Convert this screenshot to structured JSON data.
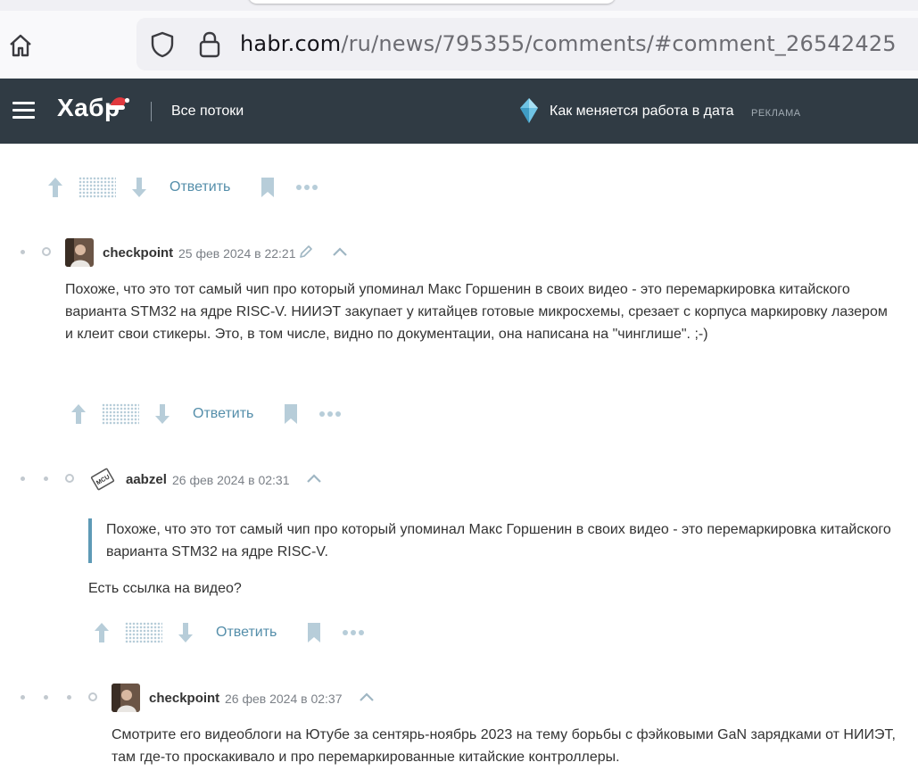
{
  "browser": {
    "url_host": "habr.com",
    "url_path": "/ru/news/795355/comments/#comment_26542425"
  },
  "header": {
    "logo": "Хабр",
    "streams": "Все потоки",
    "ad_text": "Как меняется работа в дата",
    "ad_label": "РЕКЛАМА"
  },
  "colors": {
    "header_bg": "#303b44",
    "link": "#548eaa",
    "quote_border": "#5e9ab6",
    "muted_icon": "#b7cdd9"
  },
  "icons": [
    "home-icon",
    "shield-icon",
    "lock-icon",
    "menu-icon",
    "santa-hat-icon",
    "diamond-icon",
    "upvote-icon",
    "downvote-icon",
    "bookmark-icon",
    "more-icon",
    "edit-icon",
    "collapse-icon"
  ],
  "actions": {
    "reply_label": "Ответить"
  },
  "comments": [
    {
      "author": "checkpoint",
      "time": "25 фев 2024 в 22:21",
      "text": "Похоже, что это тот самый чип про который упоминал Макс Горшенин в своих видео - это перемаркировка китайского варианта STM32 на ядре RISC-V. НИИЭТ закупает у китайцев готовые микросхемы, срезает с корпуса маркировку лазером и клеит свои стикеры. Это, в том числе, видно по документации, она написана на \"чинглише\". ;-)"
    },
    {
      "author": "aabzel",
      "time": "26 фев 2024 в 02:31",
      "avatar_text": "MCU",
      "quote": "Похоже, что это тот самый чип про который упоминал Макс Горшенин в своих видео - это перемаркировка китайского варианта STM32 на ядре RISC-V.",
      "text": "Есть ссылка на видео?"
    },
    {
      "author": "checkpoint",
      "time": "26 фев 2024 в 02:37",
      "text": "Смотрите его видеоблоги на Ютубе за сентярь-ноябрь 2023 на тему борьбы с фэйковыми GaN зарядками от НИИЭТ, там где-то проскакивало и про перемаркированные китайские контроллеры."
    }
  ]
}
